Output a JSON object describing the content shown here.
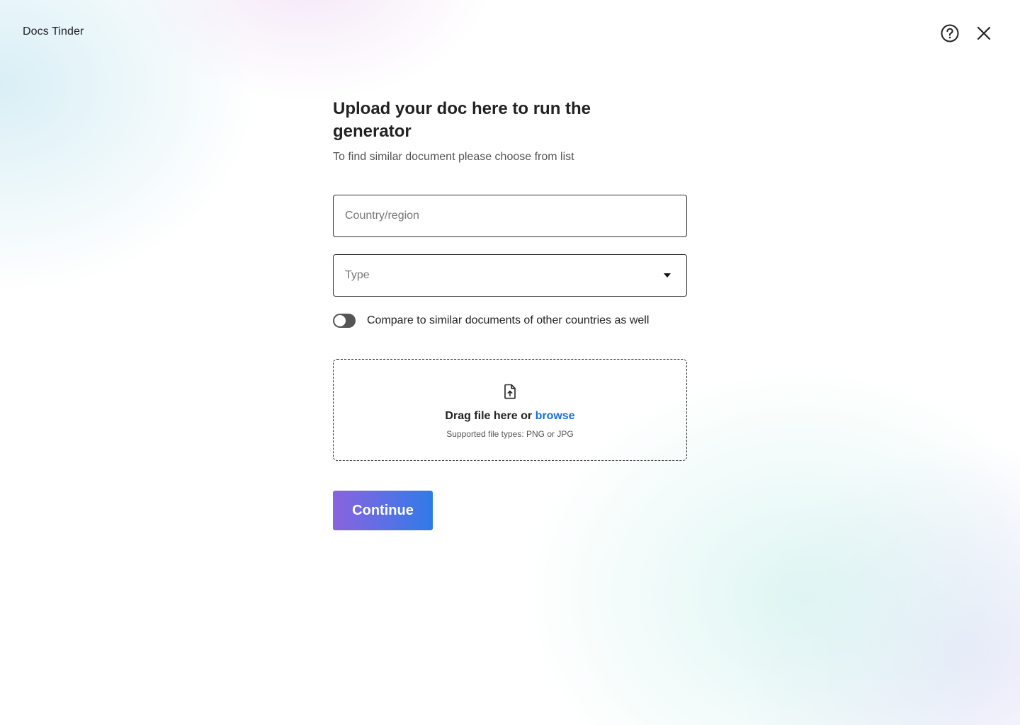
{
  "app": {
    "title": "Docs Tinder"
  },
  "header": {
    "help_icon": "help-circle-icon",
    "close_icon": "close-icon"
  },
  "main": {
    "title": "Upload your doc here to run the generator",
    "subtitle": "To find similar document please choose from list",
    "country_field": {
      "placeholder": "Country/region",
      "value": ""
    },
    "type_select": {
      "placeholder": "Type",
      "icon": "caret-down-icon"
    },
    "compare_toggle": {
      "label": "Compare to similar documents of other countries as well",
      "on": false
    },
    "dropzone": {
      "icon": "file-upload-icon",
      "prompt": "Drag file here or",
      "link": "browse",
      "hint": "Supported file types: PNG or JPG"
    },
    "continue_label": "Continue"
  },
  "colors": {
    "link": "#1a6fd6",
    "button_gradient_start": "#8a63dd",
    "button_gradient_end": "#2f7be6",
    "text": "#222222",
    "toggle_off": "#555555"
  }
}
